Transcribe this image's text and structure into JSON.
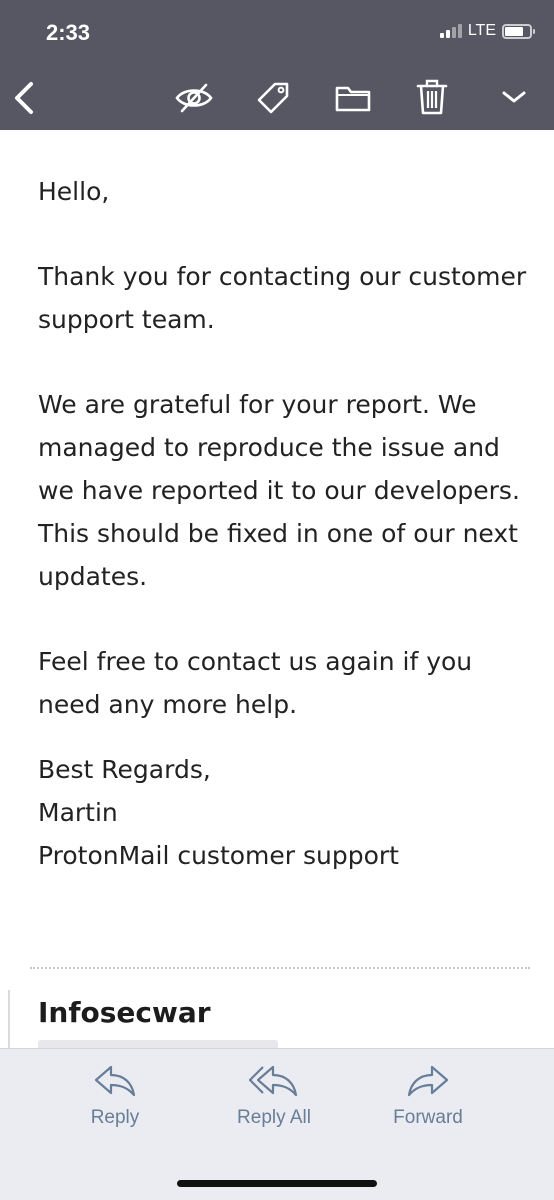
{
  "status_bar": {
    "time": "2:33",
    "network": "LTE"
  },
  "toolbar": {
    "icons": [
      "back-chevron-icon",
      "unread-eye-icon",
      "label-tag-icon",
      "move-folder-icon",
      "trash-icon",
      "more-chevron-down-icon"
    ]
  },
  "email": {
    "greeting": "Hello,",
    "paragraph1": "Thank you for contacting our customer support team.",
    "paragraph2": "We are grateful for your report. We managed to reproduce the issue and we have reported it to our developers. This should be fixed in one of our next updates.",
    "paragraph3": "Feel free to contact us again if you need any more help.",
    "signoff": "Best Regards,",
    "signer": "Martin",
    "signer_org": "ProtonMail customer support"
  },
  "next_message": {
    "sender": "Infosecwar"
  },
  "actions": {
    "reply": "Reply",
    "reply_all": "Reply All",
    "forward": "Forward"
  },
  "colors": {
    "header_bg": "#565763",
    "action_blue": "#687d98",
    "bottom_bar_bg": "#eaecf1"
  }
}
